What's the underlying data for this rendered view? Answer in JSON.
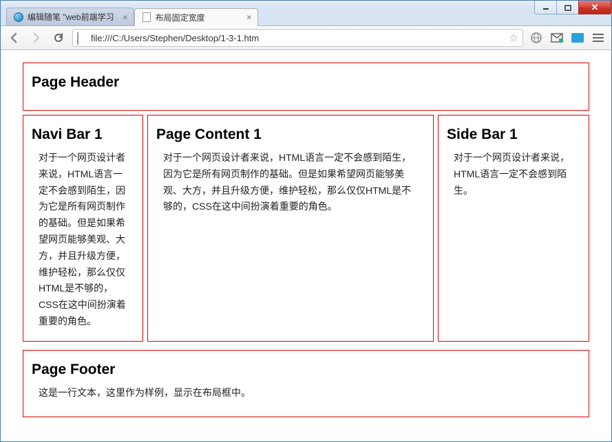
{
  "window": {
    "tabs": [
      {
        "title": "编辑随笔 \"web前端学习"
      },
      {
        "title": "布局固定宽度"
      }
    ]
  },
  "toolbar": {
    "url": "file:///C:/Users/Stephen/Desktop/1-3-1.htm"
  },
  "page": {
    "header": {
      "title": "Page Header"
    },
    "navi": {
      "title": "Navi Bar 1",
      "text": "对于一个网页设计者来说，HTML语言一定不会感到陌生，因为它是所有网页制作的基础。但是如果希望网页能够美观、大方，并且升级方便，维护轻松，那么仅仅HTML是不够的，CSS在这中间扮演着重要的角色。"
    },
    "content": {
      "title": "Page Content 1",
      "text": "对于一个网页设计者来说，HTML语言一定不会感到陌生，因为它是所有网页制作的基础。但是如果希望网页能够美观、大方，并且升级方便，维护轻松，那么仅仅HTML是不够的，CSS在这中间扮演着重要的角色。"
    },
    "sidebar": {
      "title": "Side Bar 1",
      "text": "对于一个网页设计者来说，HTML语言一定不会感到陌生。"
    },
    "footer": {
      "title": "Page Footer",
      "text": "这是一行文本，这里作为样例，显示在布局框中。"
    }
  }
}
